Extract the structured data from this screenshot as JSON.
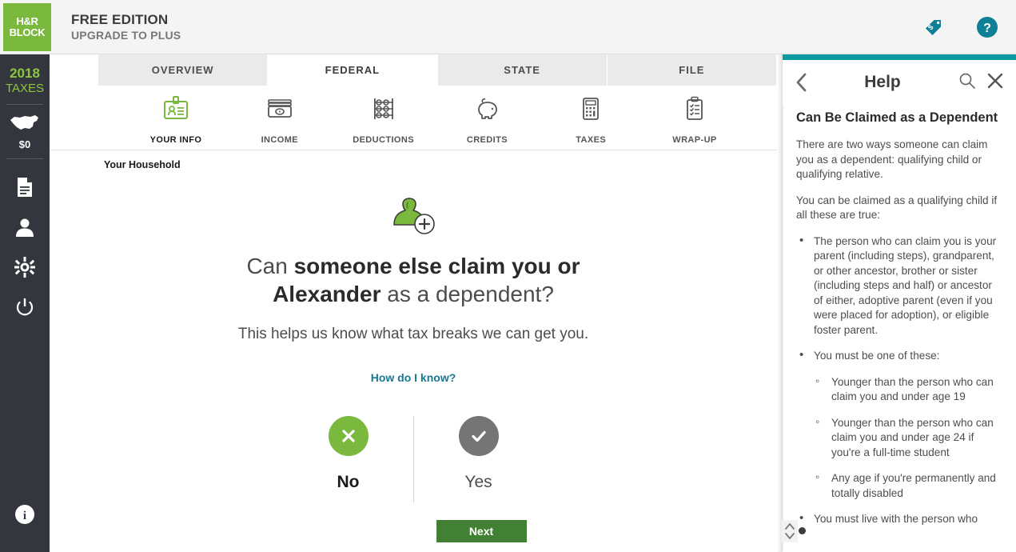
{
  "header": {
    "logo_line1": "H&R",
    "logo_line2": "BLOCK",
    "edition_title": "FREE EDITION",
    "edition_sub": "UPGRADE TO PLUS",
    "icons": [
      {
        "name": "price-tag-dollar-icon"
      },
      {
        "name": "help-question-icon"
      }
    ]
  },
  "sidebar": {
    "year": "2018",
    "year_label": "TAXES",
    "refund_amount": "$0",
    "icons": [
      {
        "name": "us-map-icon"
      },
      {
        "name": "document-icon"
      },
      {
        "name": "person-icon"
      },
      {
        "name": "gear-icon"
      },
      {
        "name": "power-icon"
      },
      {
        "name": "info-icon"
      }
    ]
  },
  "tabs": [
    {
      "label": "OVERVIEW",
      "active": false
    },
    {
      "label": "FEDERAL",
      "active": true
    },
    {
      "label": "STATE",
      "active": false
    },
    {
      "label": "FILE",
      "active": false
    }
  ],
  "subnav": [
    {
      "label": "YOUR INFO",
      "icon": "id-badge-icon",
      "active": true
    },
    {
      "label": "INCOME",
      "icon": "money-bills-icon",
      "active": false
    },
    {
      "label": "DEDUCTIONS",
      "icon": "abacus-icon",
      "active": false
    },
    {
      "label": "CREDITS",
      "icon": "piggy-bank-icon",
      "active": false
    },
    {
      "label": "TAXES",
      "icon": "calculator-icon",
      "active": false
    },
    {
      "label": "WRAP-UP",
      "icon": "clipboard-check-icon",
      "active": false
    }
  ],
  "breadcrumb": "Your Household",
  "question": {
    "icon": "person-add-icon",
    "headline_part1": "Can ",
    "headline_bold1": "someone else claim you or",
    "headline_bold2": "Alexander",
    "headline_part2": " as a dependent?",
    "subhead": "This helps us know what tax breaks we can get you.",
    "help_link": "How do I know?",
    "choices": [
      {
        "label": "No",
        "icon": "x-mark-icon",
        "selected": true
      },
      {
        "label": "Yes",
        "icon": "check-mark-icon",
        "selected": false
      }
    ],
    "next_label": "Next"
  },
  "help": {
    "title": "Help",
    "back_icon": "chevron-left-icon",
    "search_icon": "search-icon",
    "close_icon": "close-icon",
    "article_title": "Can Be Claimed as a Dependent",
    "paragraphs": [
      "There are two ways someone can claim you as a dependent: qualifying child or qualifying relative.",
      "You can be claimed as a qualifying child if all these are true:"
    ],
    "bullets": [
      {
        "text": "The person who can claim you is your parent (including steps), grandparent, or other ancestor, brother or sister (including steps and half) or ancestor of either, adoptive parent (even if you were placed for adoption), or eligible foster parent.",
        "sub": []
      },
      {
        "text": "You must be one of these:",
        "sub": [
          "Younger than the person who can claim you and under age 19",
          "Younger than the person who can claim you and under age 24 if you're a full-time student",
          "Any age if you're permanently and totally disabled"
        ]
      },
      {
        "text": "You must live with the person who",
        "sub": []
      }
    ]
  },
  "colors": {
    "brand_green": "#7ab83e",
    "dark_green": "#428033",
    "sidebar_dark": "#33373d",
    "teal": "#0c9ba0",
    "link_teal": "#17788f",
    "gray_bubble": "#757575"
  }
}
